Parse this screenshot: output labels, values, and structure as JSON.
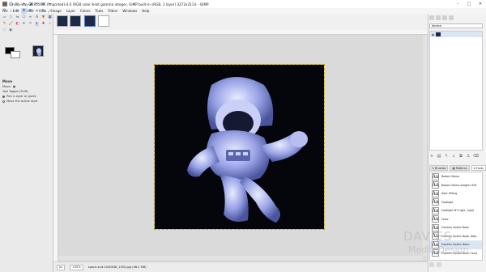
{
  "window": {
    "title": "[milky-way-2695569] (imported)-4.0 (RGB color 8-bit gamma integer, GIMP built-in sRGB, 1 layer) 3272x3114 – GIMP",
    "minimize": "–",
    "maximize": "□",
    "close": "✕"
  },
  "menubar": [
    "File",
    "Edit",
    "Select",
    "View",
    "Image",
    "Layer",
    "Colors",
    "Tools",
    "Filters",
    "Windows",
    "Help"
  ],
  "tool_options": {
    "heading": "Move",
    "move_label": "Move:",
    "tool_toggle_label": "Tool Toggle (Shift)",
    "option_pick": "Pick a layer or guide",
    "option_active": "Move the active layer"
  },
  "status": {
    "unit": "px",
    "zoom": "100%",
    "message": "space-suit-1030638_1920.jpg (46.2 MB)"
  },
  "layers": {
    "mode": "Normal",
    "buttons": [
      "+",
      "▤",
      "↑",
      "↓",
      "⧉",
      "⚓",
      "⌫"
    ]
  },
  "dock_tabs": {
    "brushes": "Brushes",
    "patterns": "Patterns",
    "fonts": "Fonts"
  },
  "fonts": [
    {
      "glyph": "Aa",
      "name": "Bodoni Demo"
    },
    {
      "glyph": "Aa",
      "name": "Bodoni Demo weight=459"
    },
    {
      "glyph": "Aa",
      "name": "Italic Fitting"
    },
    {
      "glyph": "Aa",
      "name": "Footlight"
    },
    {
      "glyph": "Aa",
      "name": "Footlight MT Light, Light"
    },
    {
      "glyph": "Aa",
      "name": "Forte"
    },
    {
      "glyph": "Aa",
      "name": "Franklin Gothic Book"
    },
    {
      "glyph": "Aa",
      "name": "Franklin Gothic Book, Italic"
    },
    {
      "glyph": "Aa",
      "name": "Franklin Gothic Demi"
    },
    {
      "glyph": "Aa",
      "name": "Franklin Gothic Demi Cond"
    }
  ],
  "watermark": {
    "line1": "DAVIES",
    "line2": "Media Design"
  }
}
